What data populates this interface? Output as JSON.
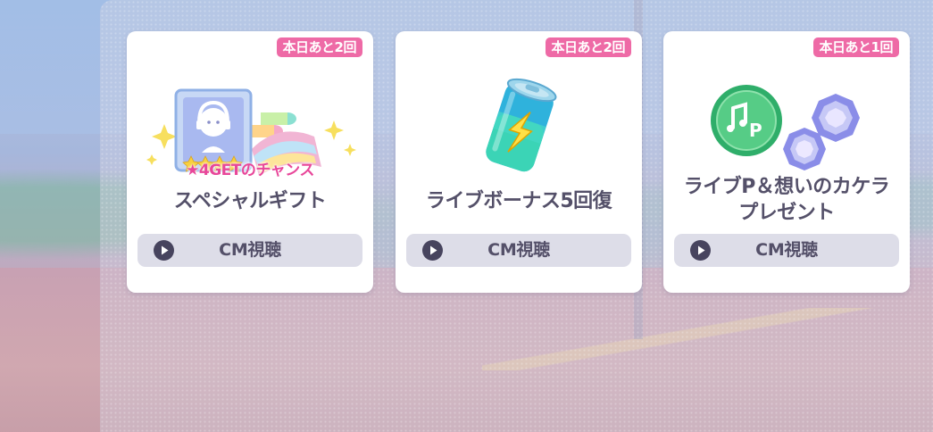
{
  "cards": [
    {
      "badge": "本日あと2回",
      "title": "スペシャルギフト",
      "art_caption": "★4GETのチャンス",
      "icon": "gift-ticket-icon",
      "button_label": "CM視聴",
      "button_icon": "play-icon"
    },
    {
      "badge": "本日あと2回",
      "title": "ライブボーナス5回復",
      "icon": "energy-drink-icon",
      "button_label": "CM視聴",
      "button_icon": "play-icon"
    },
    {
      "badge": "本日あと1回",
      "title_line1": "ライブP＆想いのカケラ",
      "title_line2": "プレゼント",
      "icon": "live-points-and-gems-icon",
      "button_label": "CM視聴",
      "button_icon": "play-icon"
    }
  ],
  "colors": {
    "badge": "#ee6aa6",
    "button": "#dddde8",
    "text": "#545069",
    "caption": "#e8479a"
  }
}
